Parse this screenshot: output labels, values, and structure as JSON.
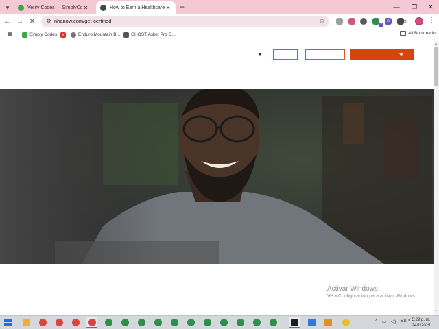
{
  "browser": {
    "tabs": [
      {
        "title": "Verify Codes — SimplyCodes",
        "active": false
      },
      {
        "title": "How to Earn a Healthcare Certi",
        "active": true
      }
    ],
    "url": "nhanow.com/get-certified",
    "bookmarks": [
      {
        "label": "Simply Codes",
        "icon": "simplycodes-icon"
      },
      {
        "label": "",
        "icon": "gmail-icon"
      },
      {
        "label": "Enduro Mountain B...",
        "icon": "enduro-icon"
      },
      {
        "label": "GHOST Asket Pro G...",
        "icon": "ghost-icon"
      }
    ],
    "all_bookmarks_label": "All Bookmarks",
    "extension_badge": "2"
  },
  "page": {
    "header_buttons": [
      {
        "label": ""
      },
      {
        "label": ""
      },
      {
        "label": ""
      }
    ]
  },
  "watermark": {
    "title": "Activar Windows",
    "subtitle": "Ve a Configuración para activar Windows."
  },
  "taskbar": {
    "language": "ESP",
    "time": "5:29 p. m.",
    "date": "24/1/2025"
  },
  "colors": {
    "accent": "#d64510",
    "tabstrip": "#f5c8d6",
    "hero_overlay": "#3b3b3b"
  }
}
